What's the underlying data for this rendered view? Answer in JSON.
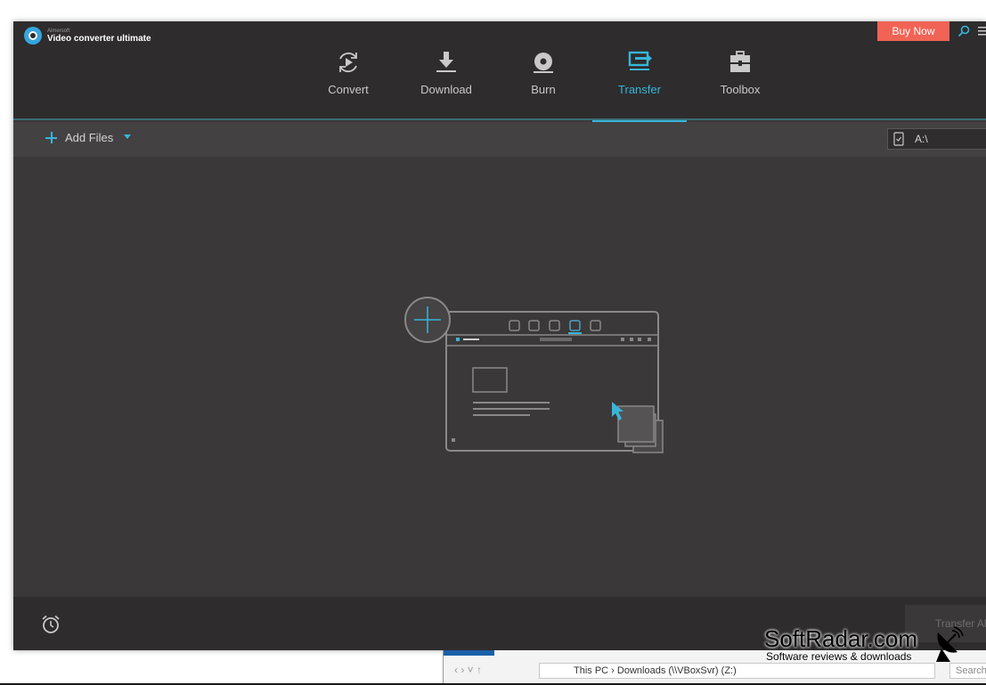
{
  "app": {
    "brand_small": "Aimersoft",
    "brand_name": "Video converter ultimate",
    "buy_now": "Buy Now"
  },
  "nav": {
    "tabs": [
      {
        "label": "Convert",
        "icon": "convert-icon",
        "active": false
      },
      {
        "label": "Download",
        "icon": "download-icon",
        "active": false
      },
      {
        "label": "Burn",
        "icon": "burn-icon",
        "active": false
      },
      {
        "label": "Transfer",
        "icon": "transfer-icon",
        "active": true
      },
      {
        "label": "Toolbox",
        "icon": "toolbox-icon",
        "active": false
      }
    ]
  },
  "toolbar": {
    "add_files": "Add Files",
    "device": "A:\\"
  },
  "footer": {
    "transfer_all": "Transfer All"
  },
  "explorer": {
    "path": "This PC  ›  Downloads (\\\\VBoxSvr) (Z:)",
    "search_placeholder": "Search"
  },
  "watermark": {
    "title": "SoftRadar.com",
    "tagline": "Software reviews & downloads"
  },
  "colors": {
    "accent": "#37b6d9",
    "buy_button": "#f16355",
    "topbar": "#2e2c2d",
    "content": "#3b3839"
  }
}
